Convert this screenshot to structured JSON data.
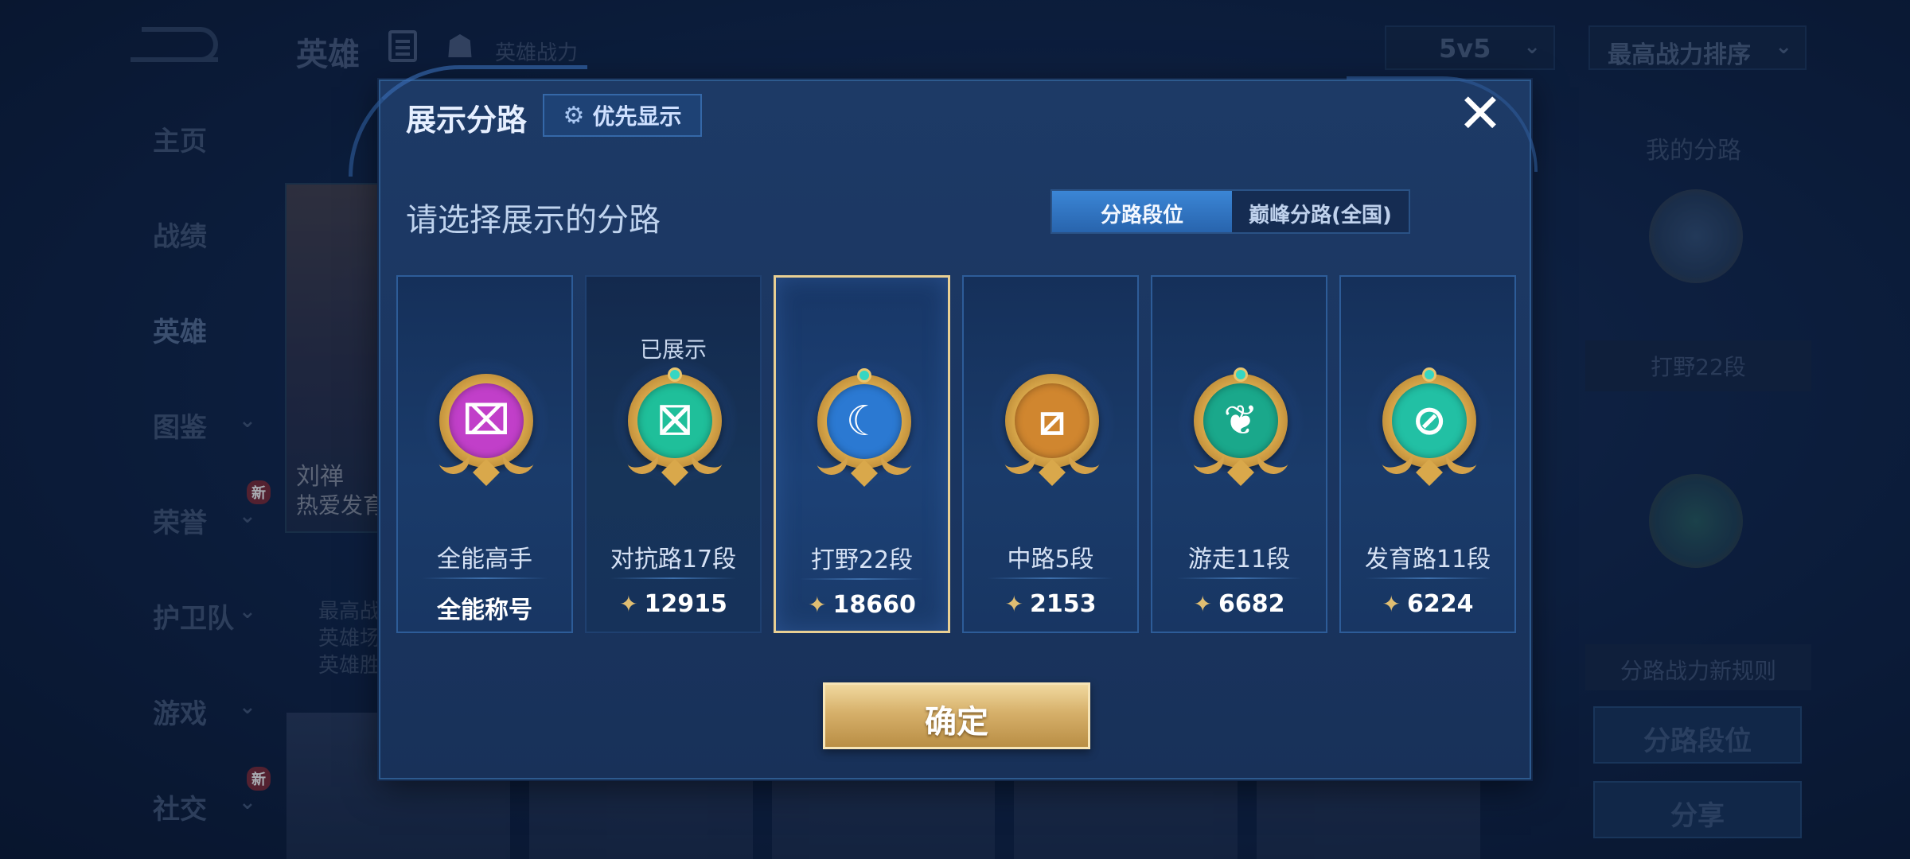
{
  "background": {
    "title": "英雄",
    "power_label": "英雄战力",
    "mode_select": "5v5",
    "sort_select": "最高战力排序",
    "nav_items": [
      {
        "label": "主页",
        "chevron": false,
        "badge": ""
      },
      {
        "label": "战绩",
        "chevron": false,
        "badge": ""
      },
      {
        "label": "英雄",
        "chevron": false,
        "badge": ""
      },
      {
        "label": "图鉴",
        "chevron": true,
        "badge": ""
      },
      {
        "label": "荣誉",
        "chevron": true,
        "badge": "新"
      },
      {
        "label": "护卫队",
        "chevron": true,
        "badge": ""
      },
      {
        "label": "游戏",
        "chevron": true,
        "badge": ""
      },
      {
        "label": "社交",
        "chevron": true,
        "badge": "新"
      }
    ],
    "hero_name": "刘禅",
    "hero_subtitle": "热爱发育",
    "hero_stats": [
      "最高战",
      "英雄场",
      "英雄胜"
    ],
    "right_panel": {
      "title": "我的分路",
      "lane_label": "打野22段",
      "rule_label": "分路战力新规则",
      "lane_rank_button": "分路段位",
      "share_button": "分享"
    }
  },
  "modal": {
    "title": "展示分路",
    "priority_button": "优先显示",
    "subtitle": "请选择展示的分路",
    "tabs": [
      {
        "label": "分路段位",
        "active": true
      },
      {
        "label": "巅峰分路(全国)",
        "active": false
      }
    ],
    "cards": [
      {
        "name": "全能高手",
        "value": "全能称号",
        "shows_power_icon": false,
        "shown_label": "",
        "selected": false,
        "medal_color": "#c13fc9",
        "medal_icon": "all-round-icon"
      },
      {
        "name": "对抗路17段",
        "value": "12915",
        "shows_power_icon": true,
        "shown_label": "已展示",
        "selected": false,
        "medal_color": "#1fbf9a",
        "medal_icon": "clash-lane-icon"
      },
      {
        "name": "打野22段",
        "value": "18660",
        "shows_power_icon": true,
        "shown_label": "",
        "selected": true,
        "medal_color": "#2b79d2",
        "medal_icon": "jungle-dragon-icon"
      },
      {
        "name": "中路5段",
        "value": "2153",
        "shows_power_icon": true,
        "shown_label": "",
        "selected": false,
        "medal_color": "#d0862f",
        "medal_icon": "mid-lane-icon"
      },
      {
        "name": "游走11段",
        "value": "6682",
        "shows_power_icon": true,
        "shown_label": "",
        "selected": false,
        "medal_color": "#1aa88b",
        "medal_icon": "roam-wings-icon"
      },
      {
        "name": "发育路11段",
        "value": "6224",
        "shows_power_icon": true,
        "shown_label": "",
        "selected": false,
        "medal_color": "#22c0a4",
        "medal_icon": "farm-lane-icon"
      }
    ],
    "confirm_button": "确定"
  }
}
